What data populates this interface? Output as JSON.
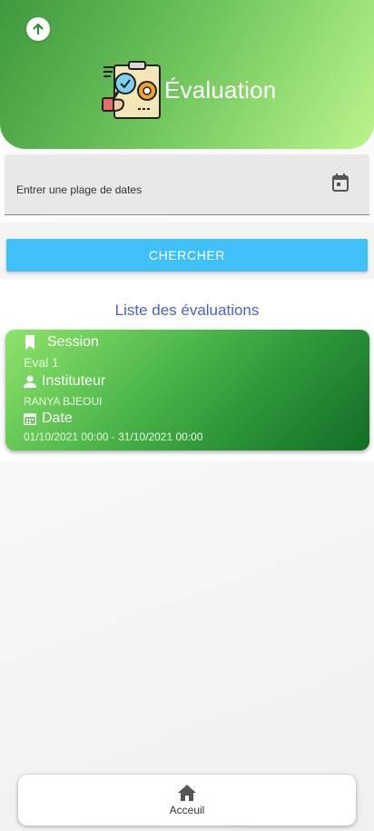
{
  "header": {
    "title": "Évaluation",
    "back_icon": "arrow-up-icon",
    "logo_icon": "evaluation-clipboard-icon",
    "gradient": [
      "#3e9a3e",
      "#b9f58b"
    ]
  },
  "date_filter": {
    "placeholder": "Entrer une plage de dates",
    "icon": "calendar-icon"
  },
  "search": {
    "label": "CHERCHER",
    "color": "#3fc0f7"
  },
  "list": {
    "title": "Liste des évaluations",
    "title_color": "#4a63c9",
    "items": [
      {
        "session_label": "Session",
        "session_value": "Eval 1",
        "teacher_label": "Instituteur",
        "teacher_value": "RANYA BJEOUI",
        "date_label": "Date",
        "date_value": "01/10/2021 00:00 - 31/10/2021 00:00"
      }
    ]
  },
  "bottom_nav": {
    "home_label": "Acceuil",
    "home_icon": "home-icon"
  }
}
